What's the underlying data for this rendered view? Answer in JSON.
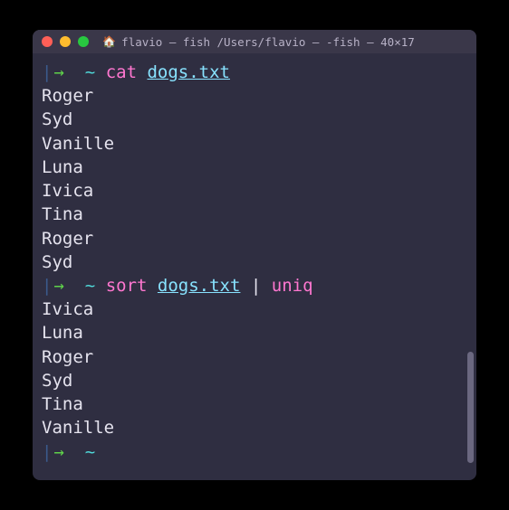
{
  "window": {
    "title": "flavio — fish /Users/flavio — -fish — 40×17",
    "title_icon": "🏠"
  },
  "prompt": {
    "bar": "|",
    "arrow": "→",
    "tilde": "~"
  },
  "block1": {
    "command": "cat",
    "arg": "dogs.txt",
    "output": [
      "Roger",
      "Syd",
      "Vanille",
      "Luna",
      "Ivica",
      "Tina",
      "Roger",
      "Syd"
    ]
  },
  "block2": {
    "command": "sort",
    "arg": "dogs.txt",
    "pipe": "|",
    "command2": "uniq",
    "output": [
      "Ivica",
      "Luna",
      "Roger",
      "Syd",
      "Tina",
      "Vanille"
    ]
  }
}
